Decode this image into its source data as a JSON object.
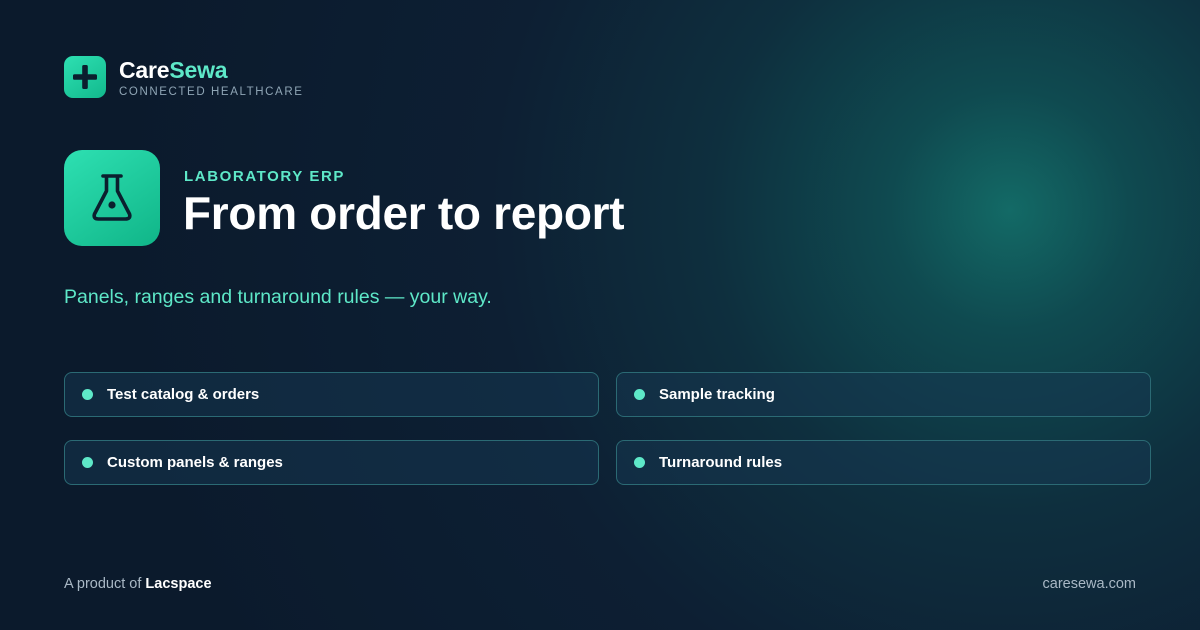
{
  "brand": {
    "name_part1": "Care",
    "name_part2": "Sewa",
    "tagline": "CONNECTED HEALTHCARE",
    "logo_icon": "plus-icon",
    "accent_color": "#5ee8c8"
  },
  "hero": {
    "icon": "flask-icon",
    "eyebrow": "LABORATORY ERP",
    "headline": "From order to report",
    "subline": "Panels, ranges and turnaround rules — your way."
  },
  "features": [
    {
      "label": "Test catalog & orders"
    },
    {
      "label": "Sample tracking"
    },
    {
      "label": "Custom panels & ranges"
    },
    {
      "label": "Turnaround rules"
    }
  ],
  "footer": {
    "prefix": "A product of ",
    "company": "Lacspace",
    "website": "caresewa.com"
  }
}
